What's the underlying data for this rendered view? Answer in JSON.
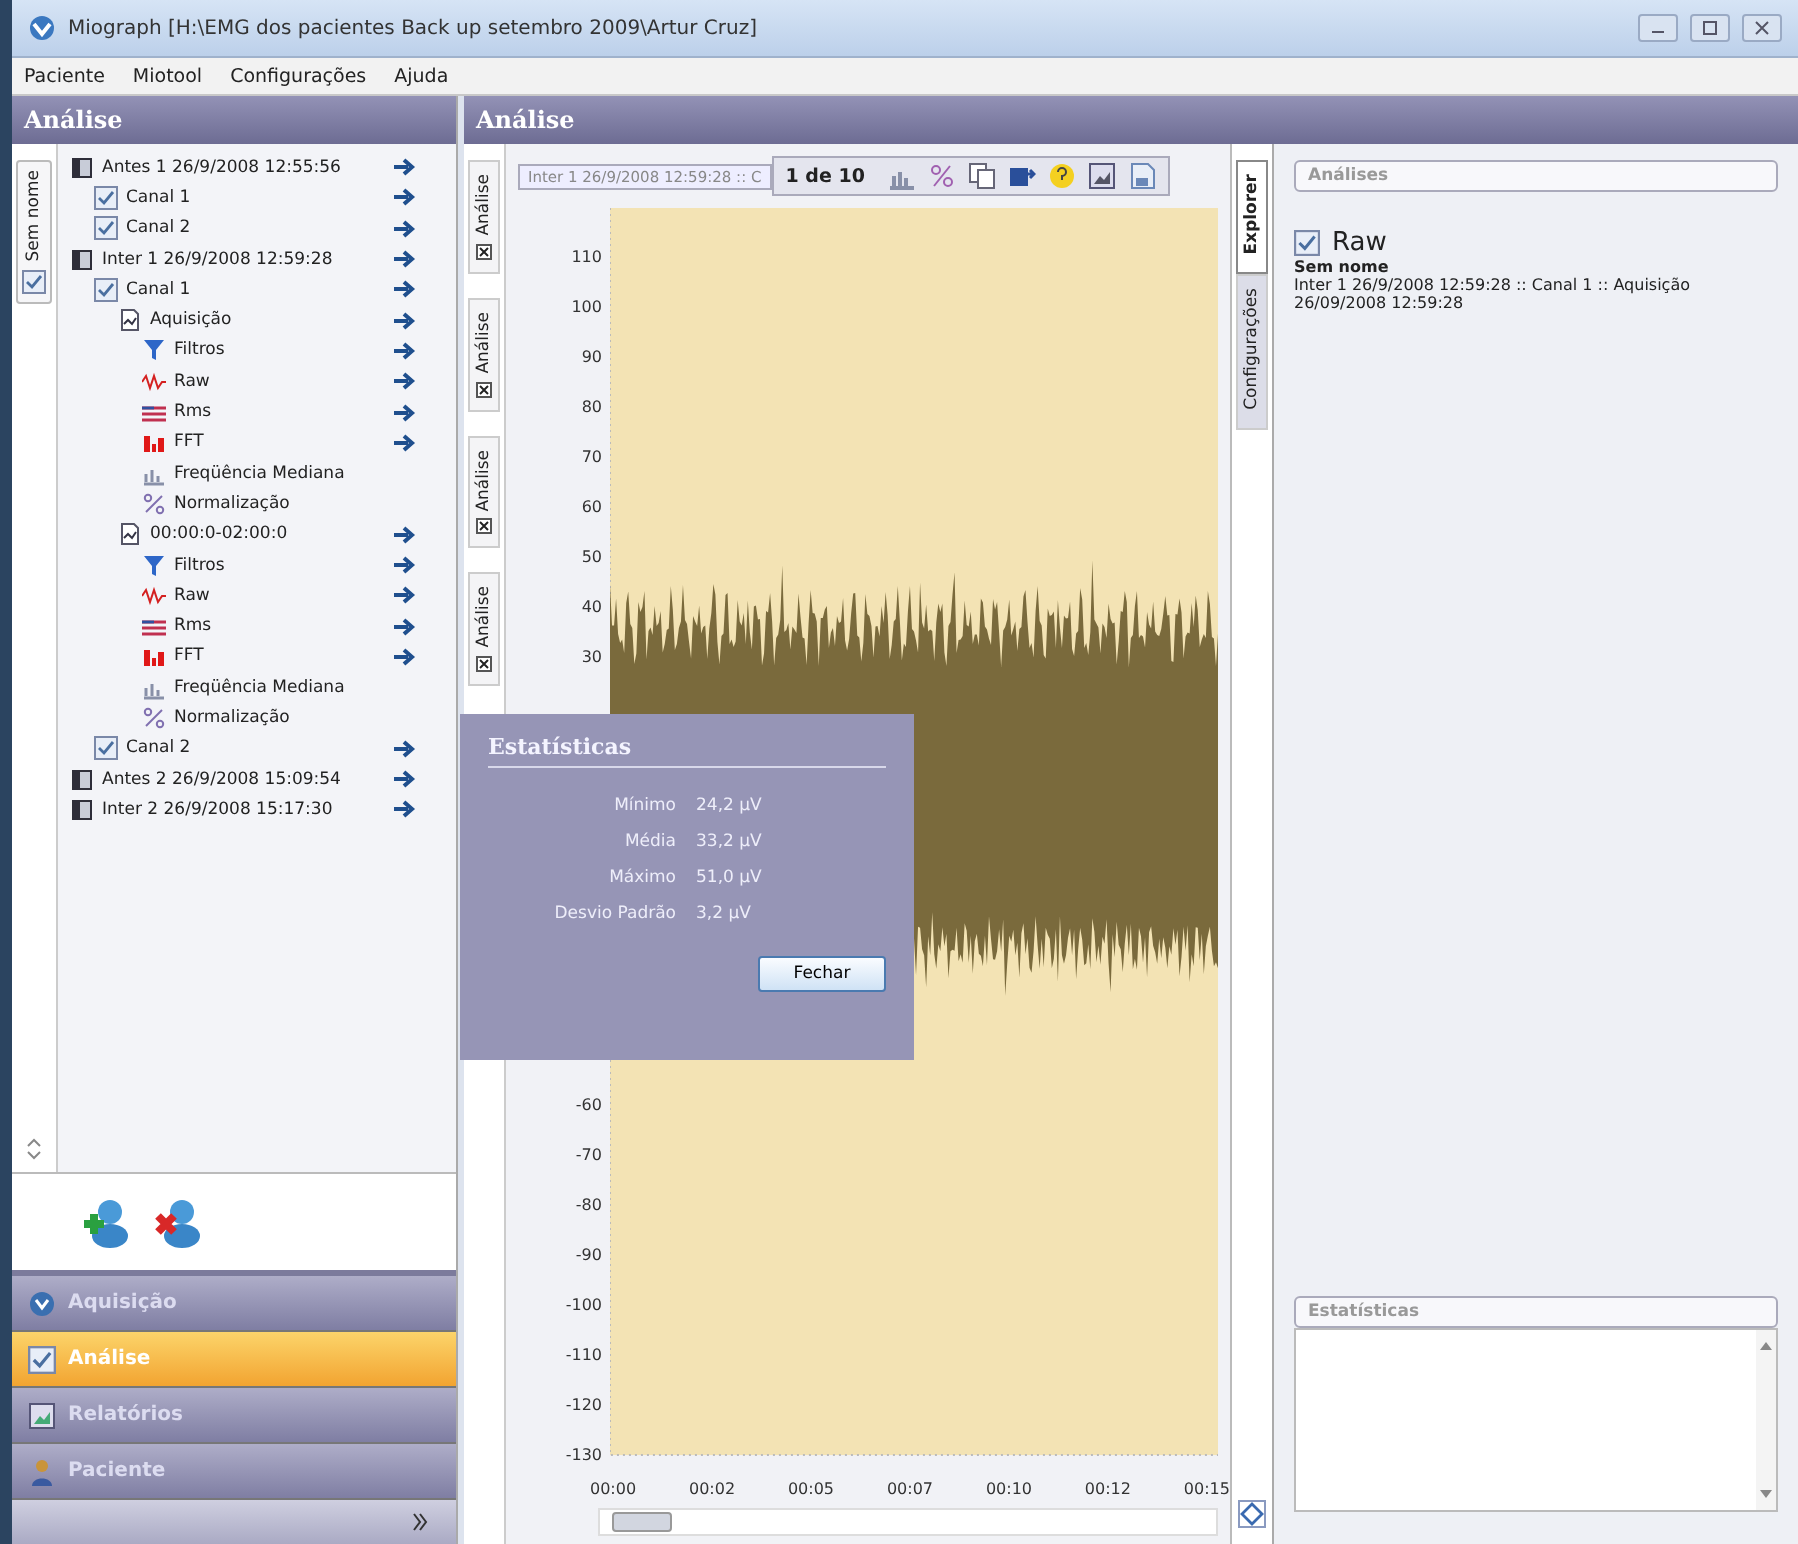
{
  "window": {
    "title": "Miograph [H:\\EMG dos pacientes Back up setembro 2009\\Artur Cruz]"
  },
  "menu": [
    "Paciente",
    "Miotool",
    "Configurações",
    "Ajuda"
  ],
  "left_panel": {
    "title": "Análise",
    "side_tab": "Sem nome",
    "tree": [
      {
        "label": "Antes 1 26/9/2008 12:55:56",
        "kind": "session",
        "arrow": true,
        "children": [
          {
            "label": "Canal 1",
            "kind": "channel",
            "arrow": true
          },
          {
            "label": "Canal 2",
            "kind": "channel",
            "arrow": true
          }
        ]
      },
      {
        "label": "Inter 1 26/9/2008 12:59:28",
        "kind": "session",
        "arrow": true,
        "children": [
          {
            "label": "Canal 1",
            "kind": "channel",
            "arrow": true,
            "children": [
              {
                "label": "Aquisição",
                "kind": "record",
                "arrow": true,
                "children": [
                  {
                    "label": "Filtros",
                    "kind": "filter",
                    "arrow": true
                  },
                  {
                    "label": "Raw",
                    "kind": "raw",
                    "arrow": true
                  },
                  {
                    "label": "Rms",
                    "kind": "rms",
                    "arrow": true
                  },
                  {
                    "label": "FFT",
                    "kind": "fft",
                    "arrow": true
                  },
                  {
                    "label": "Freqüência Mediana",
                    "kind": "median",
                    "arrow": false
                  },
                  {
                    "label": "Normalização",
                    "kind": "normalization",
                    "arrow": false
                  }
                ]
              },
              {
                "label": "00:00:0-02:00:0",
                "kind": "record",
                "arrow": true,
                "children": [
                  {
                    "label": "Filtros",
                    "kind": "filter",
                    "arrow": true
                  },
                  {
                    "label": "Raw",
                    "kind": "raw",
                    "arrow": true
                  },
                  {
                    "label": "Rms",
                    "kind": "rms",
                    "arrow": true
                  },
                  {
                    "label": "FFT",
                    "kind": "fft",
                    "arrow": true
                  },
                  {
                    "label": "Freqüência Mediana",
                    "kind": "median",
                    "arrow": false
                  },
                  {
                    "label": "Normalização",
                    "kind": "normalization",
                    "arrow": false
                  }
                ]
              }
            ]
          },
          {
            "label": "Canal 2",
            "kind": "channel",
            "arrow": true
          }
        ]
      },
      {
        "label": "Antes 2 26/9/2008 15:09:54",
        "kind": "session",
        "arrow": true
      },
      {
        "label": "Inter 2 26/9/2008 15:17:30",
        "kind": "session",
        "arrow": true
      }
    ],
    "nav": [
      {
        "label": "Aquisição",
        "kind": "acquisition",
        "selected": false
      },
      {
        "label": "Análise",
        "kind": "analysis",
        "selected": true
      },
      {
        "label": "Relatórios",
        "kind": "reports",
        "selected": false
      },
      {
        "label": "Paciente",
        "kind": "patient",
        "selected": false
      }
    ]
  },
  "analysis": {
    "title": "Análise",
    "side_tabs": [
      "Análise",
      "Análise",
      "Análise",
      "Análise"
    ],
    "chart": {
      "title": "Inter 1 26/9/2008 12:59:28 :: C",
      "page": "1 de 10",
      "y_labels_upper": [
        "110",
        "100",
        "90",
        "80",
        "70",
        "60",
        "50",
        "40",
        "30"
      ],
      "y_labels_lower": [
        "-60",
        "-70",
        "-80",
        "-90",
        "-100",
        "-110",
        "-120",
        "-130"
      ],
      "x_labels": [
        "00:00",
        "00:02",
        "00:05",
        "00:07",
        "00:10",
        "00:12",
        "00:15"
      ]
    },
    "statistics_dialog": {
      "title": "Estatísticas",
      "rows": [
        {
          "label": "Mínimo",
          "value": "24,2 µV"
        },
        {
          "label": "Média",
          "value": "33,2 µV"
        },
        {
          "label": "Máximo",
          "value": "51,0 µV"
        },
        {
          "label": "Desvio Padrão",
          "value": "3,2 µV"
        }
      ],
      "button": "Fechar"
    }
  },
  "right_panel": {
    "tabs": [
      {
        "label": "Explorer",
        "selected": true
      },
      {
        "label": "Configurações",
        "selected": false
      }
    ],
    "group": "Análises",
    "item": {
      "title": "Raw",
      "checked": true,
      "name": "Sem nome",
      "path": "Inter 1 26/9/2008 12:59:28 :: Canal 1 :: Aquisição",
      "date": "26/09/2008 12:59:28"
    },
    "statistics_title": "Estatísticas"
  }
}
